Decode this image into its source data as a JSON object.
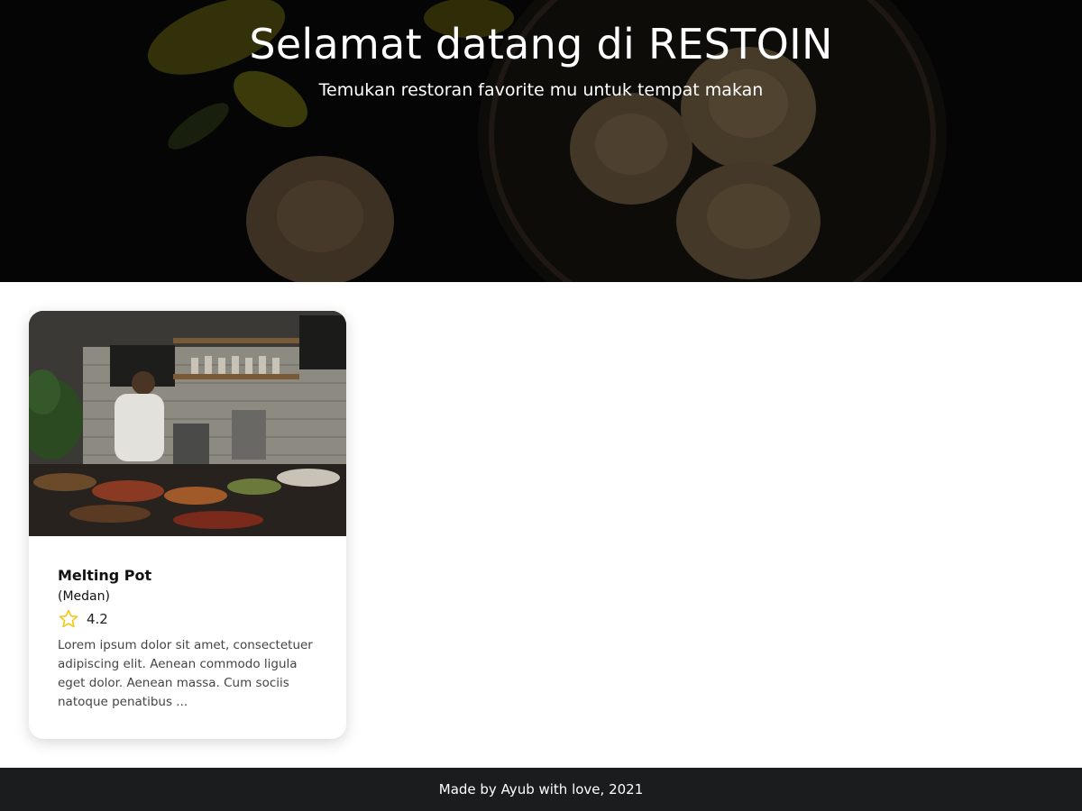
{
  "hero": {
    "title": "Selamat datang di RESTOIN",
    "subtitle": "Temukan restoran favorite mu untuk tempat makan"
  },
  "restaurants": [
    {
      "name": "Melting Pot",
      "city": "(Medan)",
      "rating": "4.2",
      "description": "Lorem ipsum dolor sit amet, consectetuer adipiscing elit. Aenean commodo ligula eget dolor. Aenean massa. Cum sociis natoque penatibus ..."
    }
  ],
  "footer": {
    "text": "Made by Ayub with love, 2021"
  },
  "colors": {
    "footer_bg": "#1b1c1e",
    "star": "#f5c518",
    "hero_overlay": "#000000"
  },
  "icons": {
    "rating": "star-outline-icon"
  }
}
